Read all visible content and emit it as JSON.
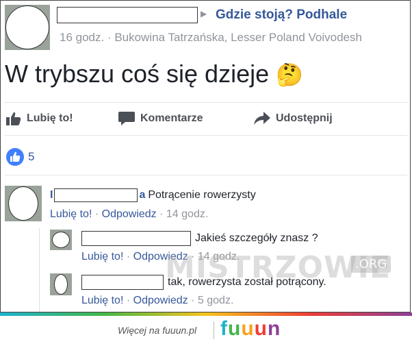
{
  "post": {
    "group_name": "Gdzie stoją? Podhale",
    "meta": "16 godz. · Bukowina Tatrzańska, Lesser Poland Voivodesh",
    "text": "W trybszu coś się dzieje",
    "emoji": "🤔"
  },
  "actions": {
    "like": "Lubię to!",
    "comment": "Komentarze",
    "share": "Udostępnij"
  },
  "reactions": {
    "count": "5"
  },
  "comments": [
    {
      "text": "Potrącenie rowerzysty",
      "like": "Lubię to!",
      "reply": "Odpowiedz",
      "time": "14 godz."
    },
    {
      "text": "Jakieś szczegóły znasz ?",
      "like": "Lubię to!",
      "reply": "Odpowiedz",
      "time": "14 godz."
    },
    {
      "text": "tak, rowerzysta został potrącony.",
      "like": "Lubię to!",
      "reply": "Odpowiedz",
      "time": "5 godz."
    }
  ],
  "separator": "·",
  "watermark": {
    "main": "MISTRZOWIE",
    "org": ".ORG"
  },
  "footer": {
    "more_text": "Więcej na fuuun.pl",
    "brand": "fuuun"
  },
  "colors": {
    "link": "#365899",
    "muted": "#90949c",
    "like_blue": "#4080ff",
    "brand_letters": [
      "#1fb2d0",
      "#43b649",
      "#f7a21e",
      "#ee3e36",
      "#8c3f97"
    ]
  }
}
